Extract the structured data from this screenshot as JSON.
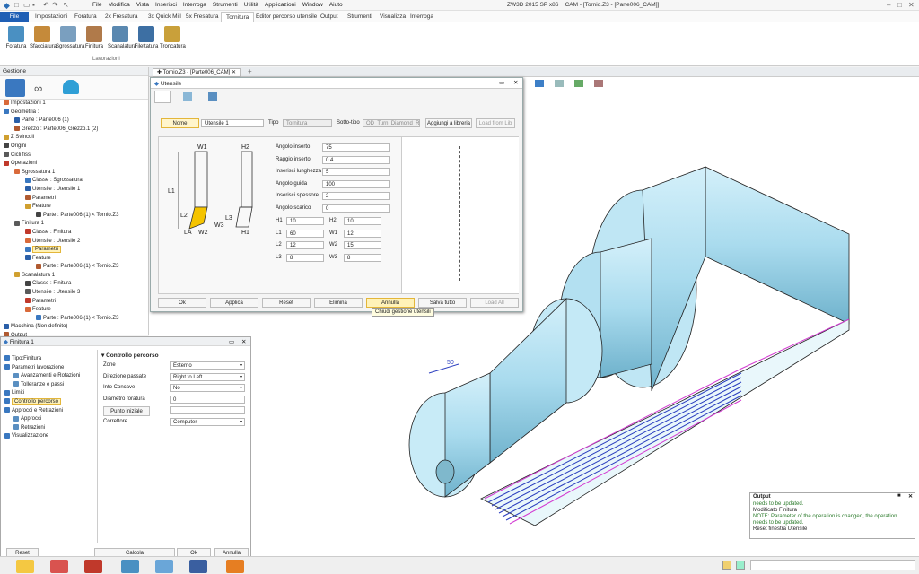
{
  "app": {
    "title": "ZW3D 2015 SP x86",
    "document": "CAM - [Tornio.Z3 - [Parte006_CAM]]"
  },
  "menus": [
    "File",
    "Modifica",
    "Vista",
    "Inserisci",
    "Interroga",
    "Strumenti",
    "Utilità",
    "Applicazioni",
    "Window",
    "Aiuto"
  ],
  "ribbon_tabs": [
    "File",
    "Impostazioni",
    "Foratura",
    "2x Fresatura",
    "3x Quick Mill",
    "5x Fresatura",
    "Tornitura",
    "Editor percorso utensile",
    "Output",
    "Strumenti",
    "Visualizza",
    "Interroga"
  ],
  "ribbon_tabs_active": "Tornitura",
  "ribbon": {
    "buttons": [
      "Foratura",
      "Sfacciatura",
      "Sgrossatura",
      "Finitura",
      "Scanalatura",
      "Filettatura",
      "Troncatura"
    ],
    "group": "Lavorazioni"
  },
  "manager": {
    "title": "Gestione",
    "tree": [
      {
        "t": "Impostazioni 1",
        "l": 0
      },
      {
        "t": "Geometria :",
        "l": 0
      },
      {
        "t": "Parte : Parte006 (1)",
        "l": 1
      },
      {
        "t": "Grezzo : Parte006_Grezzo.1 (2)",
        "l": 1
      },
      {
        "t": "Z Svincoli",
        "l": 0
      },
      {
        "t": "Origini",
        "l": 0
      },
      {
        "t": "Cicli fissi",
        "l": 0
      },
      {
        "t": "Operazioni",
        "l": 0
      },
      {
        "t": "Sgrossatura 1",
        "l": 1
      },
      {
        "t": "Classe : Sgrossatura",
        "l": 2
      },
      {
        "t": "Utensile : Utensile 1",
        "l": 2
      },
      {
        "t": "Parametri",
        "l": 2
      },
      {
        "t": "Feature",
        "l": 2
      },
      {
        "t": "Parte : Parte006 (1) < Tornio.Z3",
        "l": 3
      },
      {
        "t": "Finitura 1",
        "l": 1
      },
      {
        "t": "Classe : Finitura",
        "l": 2
      },
      {
        "t": "Utensile : Utensile 2",
        "l": 2
      },
      {
        "t": "Parametri",
        "l": 2,
        "hl": true
      },
      {
        "t": "Feature",
        "l": 2
      },
      {
        "t": "Parte : Parte006 (1) < Tornio.Z3",
        "l": 3
      },
      {
        "t": "Scanalatura 1",
        "l": 1
      },
      {
        "t": "Classe : Finitura",
        "l": 2
      },
      {
        "t": "Utensile : Utensile 3",
        "l": 2
      },
      {
        "t": "Parametri",
        "l": 2
      },
      {
        "t": "Feature",
        "l": 2
      },
      {
        "t": "Parte : Parte006 (1) < Tornio.Z3",
        "l": 3
      },
      {
        "t": "Macchina (Non definito)",
        "l": 0
      },
      {
        "t": "Output",
        "l": 0
      }
    ]
  },
  "doc_tab": "Tornio.Z3 - [Parte006_CAM]",
  "dialog": {
    "title": "Utensile",
    "nome_btn": "Nome",
    "nome_value": "Utensile 1",
    "tipo_label": "Tipo",
    "tipo_value": "Tornitura",
    "sottotipo_label": "Sotto-tipo",
    "sottotipo_value": "OD_Turn_Diamond_R",
    "add_lib": "Aggiungi a libreria",
    "load_lib": "Load from Lib",
    "params": [
      {
        "label": "Angolo inserto",
        "value": "75"
      },
      {
        "label": "Raggio inserto",
        "value": "0.4"
      },
      {
        "label": "Inserisci lunghezza",
        "value": "5"
      },
      {
        "label": "Angolo guida",
        "value": "100"
      },
      {
        "label": "Inserisci spessore",
        "value": "2"
      },
      {
        "label": "Angolo scarico",
        "value": "0"
      }
    ],
    "dims": [
      {
        "a": "H1",
        "av": "10",
        "b": "H2",
        "bv": "10"
      },
      {
        "a": "L1",
        "av": "60",
        "b": "W1",
        "bv": "12"
      },
      {
        "a": "L2",
        "av": "12",
        "b": "W2",
        "bv": "15"
      },
      {
        "a": "L3",
        "av": "8",
        "b": "W3",
        "bv": "8"
      }
    ],
    "diagram_labels": [
      "W1",
      "H2",
      "L1",
      "L2",
      "LA",
      "W2",
      "H1",
      "L3",
      "W3"
    ],
    "buttons": [
      "Ok",
      "Applica",
      "Reset",
      "Elimina",
      "Annulla",
      "Salva tutto",
      "Load All"
    ],
    "tooltip": "Chiudi gestione utensili"
  },
  "finitura": {
    "title": "Finitura 1",
    "tree": [
      {
        "t": "Tipo:Finitura",
        "l": 0
      },
      {
        "t": "Parametri lavorazione",
        "l": 0
      },
      {
        "t": "Avanzamenti e Rotazioni",
        "l": 1
      },
      {
        "t": "Tolleranze e passi",
        "l": 1
      },
      {
        "t": "Limiti",
        "l": 0
      },
      {
        "t": "Controllo percorso",
        "l": 0,
        "hl": true
      },
      {
        "t": "Approcci e Retrazioni",
        "l": 0
      },
      {
        "t": "Approcci",
        "l": 1
      },
      {
        "t": "Retrazioni",
        "l": 1
      },
      {
        "t": "Visualizzazione",
        "l": 0
      }
    ],
    "section": "Controllo percorso",
    "props": [
      {
        "label": "Zone",
        "value": "Esterno",
        "dd": true
      },
      {
        "label": "Direzione passate",
        "value": "Right to Left",
        "dd": true
      },
      {
        "label": "Into Concave",
        "value": "No",
        "dd": true
      },
      {
        "label": "Diametro foratura",
        "value": "0",
        "dd": false
      },
      {
        "label": "Punto iniziale",
        "value": "",
        "dd": false,
        "btn": true
      },
      {
        "label": "Correttore",
        "value": "Computer",
        "dd": true
      }
    ],
    "buttons": [
      "Reset",
      "Calcola",
      "Ok",
      "Annulla"
    ]
  },
  "output": {
    "title": "Output",
    "lines": [
      {
        "t": "needs to be updated.",
        "c": "#2a7a2a"
      },
      {
        "t": "Modificato Finitura",
        "c": "#222"
      },
      {
        "t": "NOTE: Parameter of the operation is changed, the operation",
        "c": "#2a7a2a"
      },
      {
        "t": "needs to be updated.",
        "c": "#2a7a2a"
      },
      {
        "t": "Reset finestra Utensile",
        "c": "#222"
      }
    ]
  },
  "viewport_label": "50"
}
